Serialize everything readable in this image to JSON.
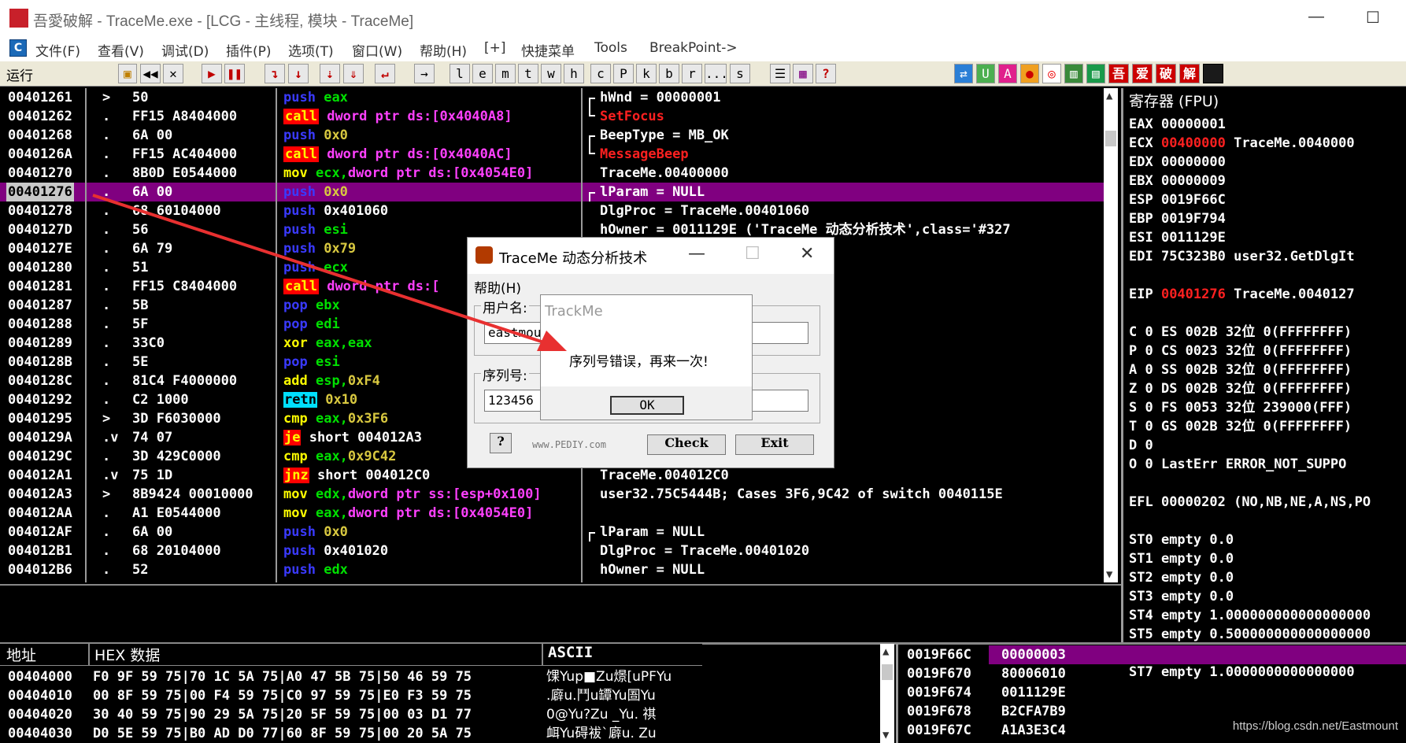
{
  "window": {
    "title": "吾愛破解 - TraceMe.exe - [LCG - 主线程, 模块 - TraceMe]",
    "logo_text": "吾愛破解",
    "minimize": "—",
    "maximize": "☐"
  },
  "menu": {
    "c_icon": "C",
    "items": [
      "文件(F)",
      "查看(V)",
      "调试(D)",
      "插件(P)",
      "选项(T)",
      "窗口(W)",
      "帮助(H)",
      "[+]",
      "快捷菜单",
      "Tools",
      "BreakPoint->"
    ]
  },
  "toolbar": {
    "status": "运行",
    "letters": [
      "l",
      "e",
      "m",
      "t",
      "w",
      "h",
      "c",
      "P",
      "k",
      "b",
      "r",
      "...",
      "s"
    ],
    "red_buttons": [
      "吾",
      "爱",
      "破",
      "解"
    ]
  },
  "disasm": [
    {
      "addr": "00401261",
      "mark": ">",
      "hex": "50",
      "op": "push",
      "args": [
        {
          "t": "eax",
          "c": "c-grn"
        }
      ],
      "cmt": "hWnd = 00000001",
      "brk": "top"
    },
    {
      "addr": "00401262",
      "mark": ".",
      "hex": "FF15 A8404000",
      "op": "call",
      "args": [
        {
          "t": "dword ptr ds:[0x4040A8]",
          "c": "c-mag"
        }
      ],
      "cmt": "SetFocus",
      "cmtc": "c-red",
      "brk": "bot"
    },
    {
      "addr": "00401268",
      "mark": ".",
      "hex": "6A 00",
      "op": "push",
      "args": [
        {
          "t": "0x0",
          "c": "c-olv"
        }
      ],
      "cmt": "BeepType = MB_OK",
      "brk": "top"
    },
    {
      "addr": "0040126A",
      "mark": ".",
      "hex": "FF15 AC404000",
      "op": "call",
      "args": [
        {
          "t": "dword ptr ds:[0x4040AC]",
          "c": "c-mag"
        }
      ],
      "cmt": "MessageBeep",
      "cmtc": "c-red",
      "brk": "bot"
    },
    {
      "addr": "00401270",
      "mark": ".",
      "hex": "8B0D E0544000",
      "op": "mov",
      "args": [
        {
          "t": "ecx,",
          "c": "c-grn"
        },
        {
          "t": "dword ptr ds:[0x4054E0]",
          "c": "c-mag"
        }
      ],
      "cmt": "TraceMe.00400000"
    },
    {
      "addr": "00401276",
      "mark": ".",
      "hex": "6A 00",
      "op": "push",
      "args": [
        {
          "t": "0x0",
          "c": "c-olv"
        }
      ],
      "cmt": "lParam = NULL",
      "sel": true,
      "brk": "top"
    },
    {
      "addr": "00401278",
      "mark": ".",
      "hex": "68 60104000",
      "op": "push",
      "args": [
        {
          "t": "0x401060",
          "c": "c-wht"
        }
      ],
      "cmt": "DlgProc = TraceMe.00401060"
    },
    {
      "addr": "0040127D",
      "mark": ".",
      "hex": "56",
      "op": "push",
      "args": [
        {
          "t": "esi",
          "c": "c-grn"
        }
      ],
      "cmt": "hOwner = 0011129E ('TraceMe 动态分析技术',class='#327"
    },
    {
      "addr": "0040127E",
      "mark": ".",
      "hex": "6A 79",
      "op": "push",
      "args": [
        {
          "t": "0x79",
          "c": "c-olv"
        }
      ],
      "cmt": ""
    },
    {
      "addr": "00401280",
      "mark": ".",
      "hex": "51",
      "op": "push",
      "args": [
        {
          "t": "ecx",
          "c": "c-grn"
        }
      ],
      "cmt": ""
    },
    {
      "addr": "00401281",
      "mark": ".",
      "hex": "FF15 C8404000",
      "op": "call",
      "args": [
        {
          "t": "dword ptr ds:[",
          "c": "c-mag"
        }
      ],
      "cmt": ""
    },
    {
      "addr": "00401287",
      "mark": ".",
      "hex": "5B",
      "op": "pop",
      "args": [
        {
          "t": "ebx",
          "c": "c-grn"
        }
      ],
      "cmt": ""
    },
    {
      "addr": "00401288",
      "mark": ".",
      "hex": "5F",
      "op": "pop",
      "args": [
        {
          "t": "edi",
          "c": "c-grn"
        }
      ],
      "cmt": ""
    },
    {
      "addr": "00401289",
      "mark": ".",
      "hex": "33C0",
      "op": "xor",
      "args": [
        {
          "t": "eax,eax",
          "c": "c-grn"
        }
      ],
      "cmt": ""
    },
    {
      "addr": "0040128B",
      "mark": ".",
      "hex": "5E",
      "op": "pop",
      "args": [
        {
          "t": "esi",
          "c": "c-grn"
        }
      ],
      "cmt": ""
    },
    {
      "addr": "0040128C",
      "mark": ".",
      "hex": "81C4 F4000000",
      "op": "add",
      "args": [
        {
          "t": "esp,",
          "c": "c-grn"
        },
        {
          "t": "0xF4",
          "c": "c-olv"
        }
      ],
      "cmt": ""
    },
    {
      "addr": "00401292",
      "mark": ".",
      "hex": "C2 1000",
      "op": "retn",
      "args": [
        {
          "t": "0x10",
          "c": "c-olv"
        }
      ],
      "cmt": ""
    },
    {
      "addr": "00401295",
      "mark": ">",
      "hex": "3D F6030000",
      "op": "cmp",
      "args": [
        {
          "t": "eax,",
          "c": "c-grn"
        },
        {
          "t": "0x3F6",
          "c": "c-olv"
        }
      ],
      "cmt": ""
    },
    {
      "addr": "0040129A",
      "mark": ".v",
      "hex": "74 07",
      "op": "je",
      "args": [
        {
          "t": "short 004012A3",
          "c": "c-wht"
        }
      ],
      "cmt": ""
    },
    {
      "addr": "0040129C",
      "mark": ".",
      "hex": "3D 429C0000",
      "op": "cmp",
      "args": [
        {
          "t": "eax,",
          "c": "c-grn"
        },
        {
          "t": "0x9C42",
          "c": "c-olv"
        }
      ],
      "cmt": ""
    },
    {
      "addr": "004012A1",
      "mark": ".v",
      "hex": "75 1D",
      "op": "jnz",
      "args": [
        {
          "t": "short 004012C0",
          "c": "c-wht"
        }
      ],
      "cmt": "TraceMe.004012C0"
    },
    {
      "addr": "004012A3",
      "mark": ">",
      "hex": "8B9424 00010000",
      "op": "mov",
      "args": [
        {
          "t": "edx,",
          "c": "c-grn"
        },
        {
          "t": "dword ptr ss:[esp+0x100]",
          "c": "c-mag"
        }
      ],
      "cmt": "user32.75C5444B; Cases 3F6,9C42 of switch 0040115E"
    },
    {
      "addr": "004012AA",
      "mark": ".",
      "hex": "A1 E0544000",
      "op": "mov",
      "args": [
        {
          "t": "eax,",
          "c": "c-grn"
        },
        {
          "t": "dword ptr ds:[0x4054E0]",
          "c": "c-mag"
        }
      ],
      "cmt": ""
    },
    {
      "addr": "004012AF",
      "mark": ".",
      "hex": "6A 00",
      "op": "push",
      "args": [
        {
          "t": "0x0",
          "c": "c-olv"
        }
      ],
      "cmt": "lParam = NULL",
      "brk": "top"
    },
    {
      "addr": "004012B1",
      "mark": ".",
      "hex": "68 20104000",
      "op": "push",
      "args": [
        {
          "t": "0x401020",
          "c": "c-wht"
        }
      ],
      "cmt": "DlgProc = TraceMe.00401020"
    },
    {
      "addr": "004012B6",
      "mark": ".",
      "hex": "52",
      "op": "push",
      "args": [
        {
          "t": "edx",
          "c": "c-grn"
        }
      ],
      "cmt": "hOwner = NULL"
    }
  ],
  "registers": {
    "header": "寄存器 (FPU)",
    "lines": [
      {
        "name": "EAX",
        "val": "00000001",
        "note": ""
      },
      {
        "name": "ECX",
        "val": "00400000",
        "note": "TraceMe.0040000",
        "red": true
      },
      {
        "name": "EDX",
        "val": "00000000",
        "note": ""
      },
      {
        "name": "EBX",
        "val": "00000009",
        "note": ""
      },
      {
        "name": "ESP",
        "val": "0019F66C",
        "note": ""
      },
      {
        "name": "EBP",
        "val": "0019F794",
        "note": ""
      },
      {
        "name": "ESI",
        "val": "0011129E",
        "note": ""
      },
      {
        "name": "EDI",
        "val": "75C323B0",
        "note": "user32.GetDlgIt"
      },
      {
        "name": "",
        "val": "",
        "note": ""
      },
      {
        "name": "EIP",
        "val": "00401276",
        "note": "TraceMe.0040127",
        "red": true
      },
      {
        "name": "",
        "val": "",
        "note": ""
      },
      {
        "name": "C 0",
        "val": "ES 002B",
        "note": "32位 0(FFFFFFFF)"
      },
      {
        "name": "P 0",
        "val": "CS 0023",
        "note": "32位 0(FFFFFFFF)"
      },
      {
        "name": "A 0",
        "val": "SS 002B",
        "note": "32位 0(FFFFFFFF)"
      },
      {
        "name": "Z 0",
        "val": "DS 002B",
        "note": "32位 0(FFFFFFFF)"
      },
      {
        "name": "S 0",
        "val": "FS 0053",
        "note": "32位 239000(FFF)"
      },
      {
        "name": "T 0",
        "val": "GS 002B",
        "note": "32位 0(FFFFFFFF)"
      },
      {
        "name": "D 0",
        "val": "",
        "note": ""
      },
      {
        "name": "O 0",
        "val": "LastErr",
        "note": "ERROR_NOT_SUPPO"
      },
      {
        "name": "",
        "val": "",
        "note": ""
      },
      {
        "name": "EFL",
        "val": "00000202",
        "note": "(NO,NB,NE,A,NS,PO"
      },
      {
        "name": "",
        "val": "",
        "note": ""
      },
      {
        "name": "ST0",
        "val": "empty",
        "note": "0.0"
      },
      {
        "name": "ST1",
        "val": "empty",
        "note": "0.0"
      },
      {
        "name": "ST2",
        "val": "empty",
        "note": "0.0"
      },
      {
        "name": "ST3",
        "val": "empty",
        "note": "0.0"
      },
      {
        "name": "ST4",
        "val": "empty",
        "note": "1.000000000000000000"
      },
      {
        "name": "ST5",
        "val": "empty",
        "note": "0.500000000000000000"
      },
      {
        "name": "ST6",
        "val": "empty",
        "note": "1.000000000000000000"
      },
      {
        "name": "ST7",
        "val": "empty",
        "note": "1.0000000000000000"
      }
    ]
  },
  "dump": {
    "head_addr": "地址",
    "head_hex": "HEX 数据",
    "head_ascii": "ASCII",
    "rows": [
      {
        "addr": "00404000",
        "hex": "F0 9F 59 75|70 1C 5A 75|A0 47 5B 75|50 46 59 75",
        "ascii": "馃Yup■Zu燝[uPFYu"
      },
      {
        "addr": "00404010",
        "hex": "00 8F 59 75|00 F4 59 75|C0 97 59 75|E0 F3 59 75",
        "ascii": ".廦u.鬥u罈Yu圄Yu"
      },
      {
        "addr": "00404020",
        "hex": "30 40 59 75|90 29 5A 75|20 5F 59 75|00 03 D1 77",
        "ascii": "0@Yu?Zu _Yu. 祺"
      },
      {
        "addr": "00404030",
        "hex": "D0 5E 59 75|B0 AD D0 77|60 8F 59 75|00 20 5A 75",
        "ascii": "衈Yu碍袚`廦u. Zu"
      }
    ]
  },
  "stack": [
    {
      "addr": "0019F66C",
      "val": "00000003",
      "sel": true
    },
    {
      "addr": "0019F670",
      "val": "80006010"
    },
    {
      "addr": "0019F674",
      "val": "0011129E"
    },
    {
      "addr": "0019F678",
      "val": "B2CFA7B9"
    },
    {
      "addr": "0019F67C",
      "val": "A1A3E3C4"
    }
  ],
  "dialog": {
    "title": "TraceMe 动态分析技术",
    "menu": "帮助(H)",
    "user_label": "用户名:",
    "user_value": "eastmou",
    "serial_label": "序列号:",
    "serial_value": "123456",
    "help_btn": "?",
    "site": "www.PEDIY.com",
    "check_btn": "Check",
    "exit_btn": "Exit",
    "min": "—",
    "max": "☐",
    "close": "✕"
  },
  "msgbox": {
    "title": "TrackMe",
    "text": "序列号错误，再来一次!",
    "ok": "OK"
  },
  "watermark": "https://blog.csdn.net/Eastmount",
  "colors": {
    "selection": "#800080",
    "arrow": "#e83030"
  }
}
